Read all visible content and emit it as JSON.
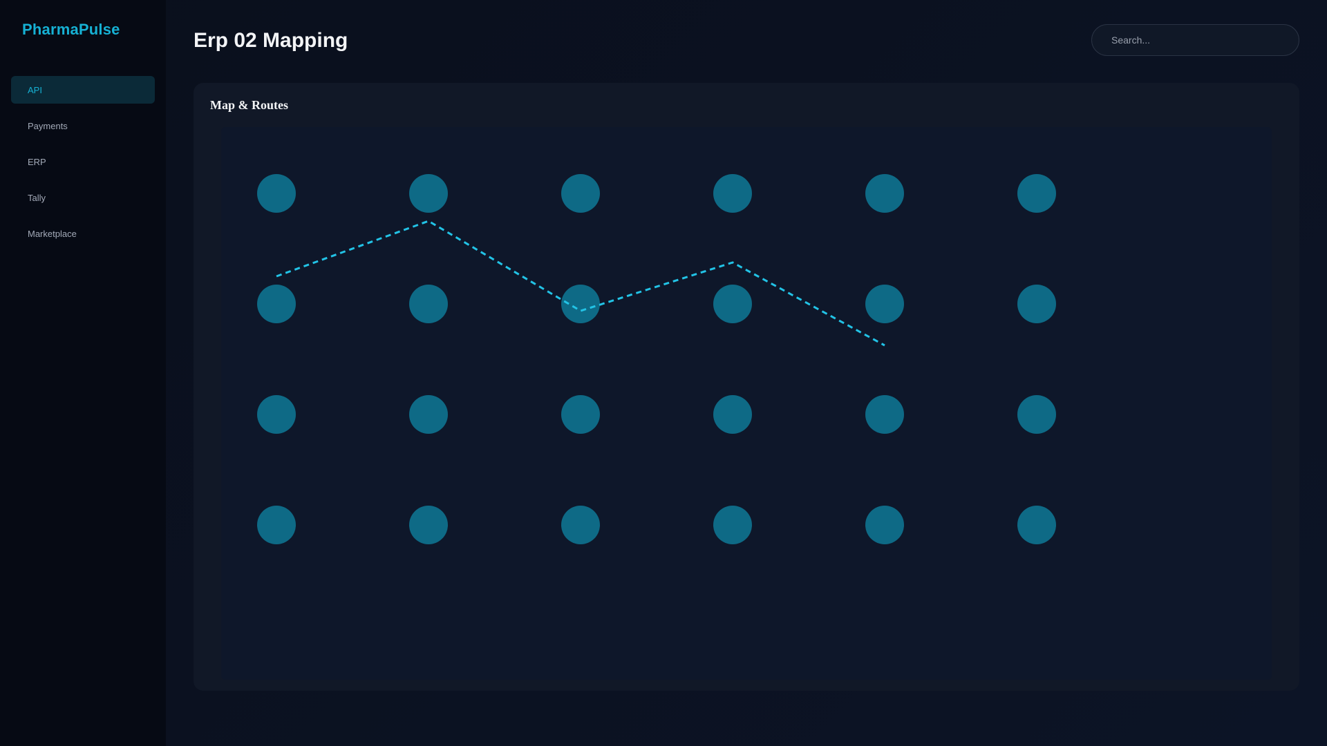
{
  "app": {
    "brand": "PharmaPulse",
    "accent_color": "#16b1d4"
  },
  "sidebar": {
    "items": [
      {
        "label": "API",
        "active": true
      },
      {
        "label": "Payments",
        "active": false
      },
      {
        "label": "ERP",
        "active": false
      },
      {
        "label": "Tally",
        "active": false
      },
      {
        "label": "Marketplace",
        "active": false
      }
    ]
  },
  "header": {
    "title": "Erp 02 Mapping",
    "search_placeholder": "Search..."
  },
  "panel": {
    "title": "Map & Routes",
    "map": {
      "node_grid": {
        "rows": 4,
        "cols": 6
      },
      "node_color": "#0e6a86",
      "route_color": "#22c3e6",
      "route_style": "dashed"
    }
  }
}
